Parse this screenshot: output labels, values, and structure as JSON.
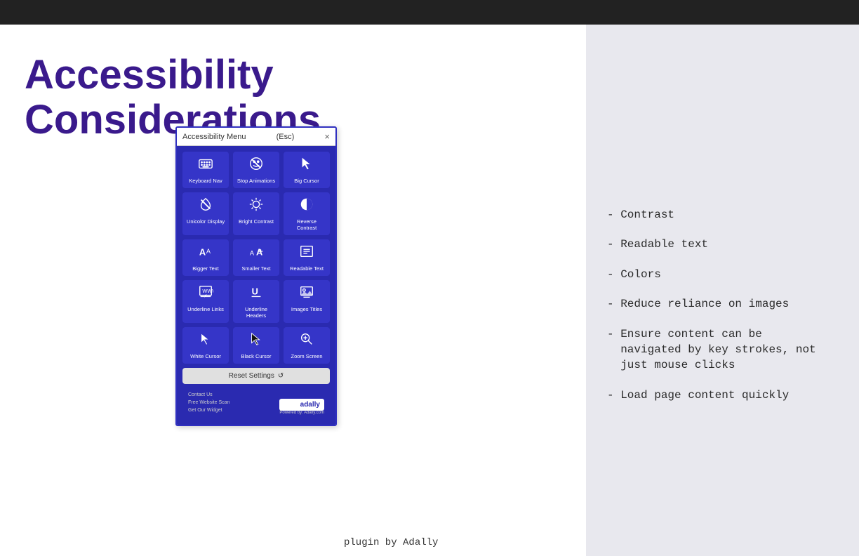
{
  "page": {
    "title": "Accessibility Considerations",
    "leopard_bar_aria": "decorative leopard pattern"
  },
  "widget": {
    "title": "Accessibility Menu",
    "esc_hint": "(Esc)",
    "close_label": "×",
    "items": [
      {
        "label": "Keyboard Nav",
        "icon": "keyboard"
      },
      {
        "label": "Stop Animations",
        "icon": "stop-anim"
      },
      {
        "label": "Big Cursor",
        "icon": "cursor"
      },
      {
        "label": "Unicolor Display",
        "icon": "unicolor"
      },
      {
        "label": "Bright Contrast",
        "icon": "brightness"
      },
      {
        "label": "Reverse Contrast",
        "icon": "reverse-contrast"
      },
      {
        "label": "Bigger Text",
        "icon": "bigger-text"
      },
      {
        "label": "Smaller Text",
        "icon": "smaller-text"
      },
      {
        "label": "Readable Text",
        "icon": "readable-text"
      },
      {
        "label": "Underline Links",
        "icon": "underline-links"
      },
      {
        "label": "Underline Headers",
        "icon": "underline-headers"
      },
      {
        "label": "Images Titles",
        "icon": "images-titles"
      },
      {
        "label": "White Cursor",
        "icon": "white-cursor"
      },
      {
        "label": "Black Cursor",
        "icon": "black-cursor"
      },
      {
        "label": "Zoom Screen",
        "icon": "zoom-screen"
      }
    ],
    "reset_label": "Reset Settings",
    "footer": {
      "contact": "Contact Us",
      "scan": "Free Website Scan",
      "widget": "Get Our Widget",
      "logo": "adally",
      "powered": "Powered by: Adally.com"
    }
  },
  "plugin_label": "plugin by Adally",
  "bullets": [
    "- Contrast",
    "- Readable text",
    "- Colors",
    "- Reduce reliance on images",
    "- Ensure content can be\n  navigated by key strokes, not\n  just mouse clicks",
    "- Load page content quickly"
  ]
}
